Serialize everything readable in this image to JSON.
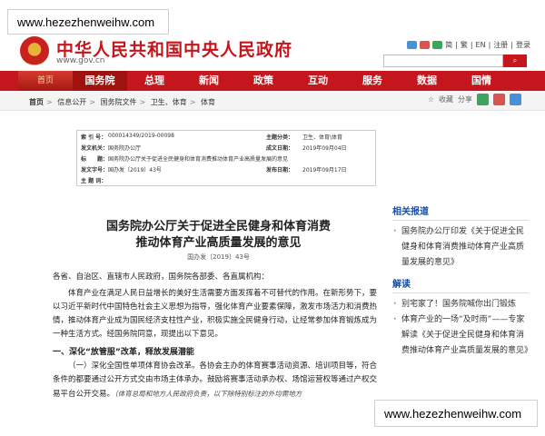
{
  "watermark": {
    "top": "www.hezezhenweihw.com",
    "bottom": "www.hezezhenweihw.com"
  },
  "header": {
    "site_name": "中华人民共和国中央人民政府",
    "site_url": "www.gov.cn",
    "links": [
      "简",
      "繁",
      "EN",
      "注册",
      "登录"
    ]
  },
  "nav": {
    "home": "首页",
    "items": [
      "国务院",
      "总理",
      "新闻",
      "政策",
      "互动",
      "服务",
      "数据",
      "国情"
    ]
  },
  "breadcrumb": [
    "首页",
    "信息公开",
    "国务院文件",
    "卫生、体育",
    "体育"
  ],
  "tools": {
    "favorite": "收藏",
    "share": "分享"
  },
  "info": {
    "index_label": "索 引 号：",
    "index_value": "000014349/2019-00098",
    "category_label": "主题分类：",
    "category_value": "卫生、体育\\体育",
    "issuer_label": "发文机关：",
    "issuer_value": "国务院办公厅",
    "created_label": "成文日期：",
    "created_value": "2019年09月04日",
    "title_label": "标　　题：",
    "title_value": "国务院办公厅关于促进全民健身和体育消费推动体育产业高质量发展的意见",
    "docno_label": "发文字号：",
    "docno_value": "国办发〔2019〕43号",
    "published_label": "发布日期：",
    "published_value": "2019年09月17日",
    "subject_label": "主 题 词：",
    "subject_value": ""
  },
  "article": {
    "title_line1": "国务院办公厅关于促进全民健身和体育消费",
    "title_line2": "推动体育产业高质量发展的意见",
    "docno": "国办发〔2019〕43号",
    "greeting": "各省、自治区、直辖市人民政府，国务院各部委、各直属机构：",
    "p1": "体育产业在满足人民日益增长的美好生活需要方面发挥着不可替代的作用。在新形势下，要以习近平新时代中国特色社会主义思想为指导，强化体育产业要素保障，激发市场活力和消费热情，推动体育产业成为国民经济支柱性产业，积极实施全民健身行动，让经常参加体育锻炼成为一种生活方式。经国务院同意，现提出以下意见。",
    "heading1": "一、深化“放管服”改革，释放发展潜能",
    "p2_main": "（一）深化全国性单项体育协会改革。各协会主办的体育赛事活动资源、培训项目等，符合条件的都要通过公开方式交由市场主体承办。鼓励将赛事活动承办权、场馆运营权等通过产权交易平台公开交易。",
    "p2_note": "（体育总局和地方人民政府负责，以下除特别标注的外均需地方"
  },
  "sidebar": {
    "related_heading": "相关报道",
    "related_items": [
      "国务院办公厅印发《关于促进全民健身和体育消费推动体育产业高质量发展的意见》"
    ],
    "interpret_heading": "解读",
    "interpret_items": [
      "别宅家了！国务院喊你出门锻炼",
      "体育产业的一场“及时雨”——专家解读《关于促进全民健身和体育消费推动体育产业高质量发展的意见》"
    ]
  }
}
